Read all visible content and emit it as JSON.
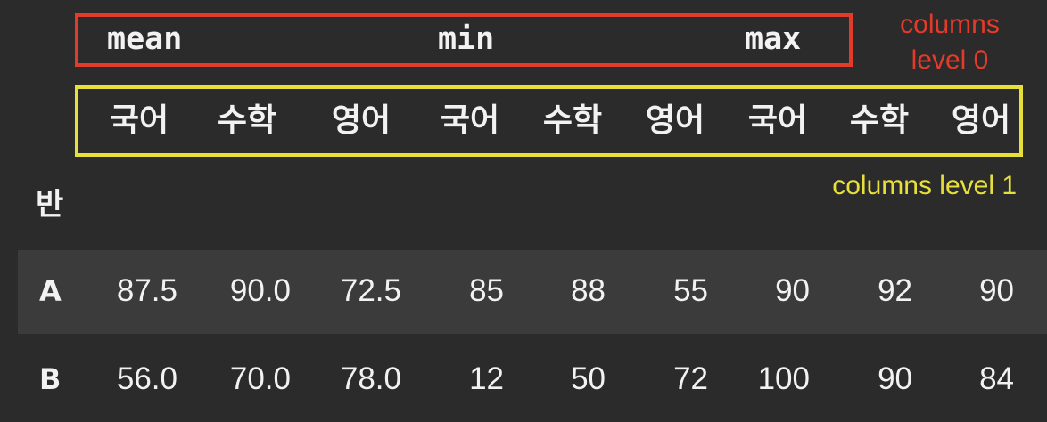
{
  "annotations": {
    "level0_line1": "columns",
    "level0_line2": "level 0",
    "level1": "columns level 1",
    "level0_color": "#e23b2a",
    "level1_color": "#e8e03a"
  },
  "columns_level0": [
    "mean",
    "min",
    "max"
  ],
  "columns_level1": [
    "국어",
    "수학",
    "영어",
    "국어",
    "수학",
    "영어",
    "국어",
    "수학",
    "영어"
  ],
  "index_name": "반",
  "rows": [
    {
      "label": "A",
      "values": [
        "87.5",
        "90.0",
        "72.5",
        "85",
        "88",
        "55",
        "90",
        "92",
        "90"
      ]
    },
    {
      "label": "B",
      "values": [
        "56.0",
        "70.0",
        "78.0",
        "12",
        "50",
        "72",
        "100",
        "90",
        "84"
      ]
    }
  ]
}
